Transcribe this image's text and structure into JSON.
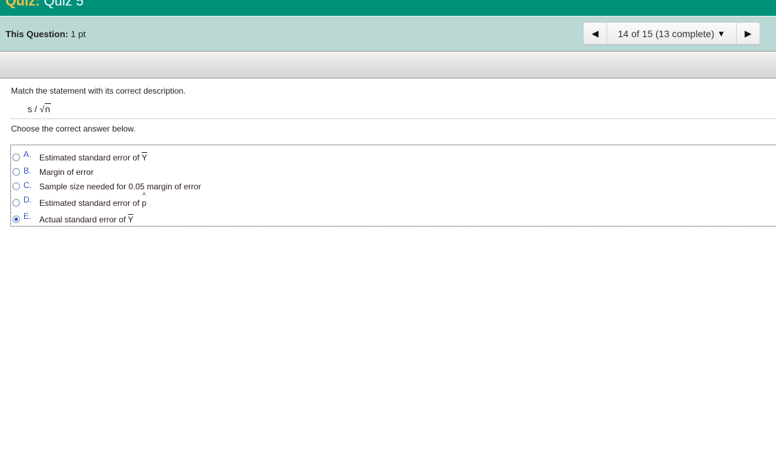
{
  "header": {
    "quiz_label": "Quiz:",
    "quiz_name": "Quiz 5"
  },
  "question_bar": {
    "label": "This Question:",
    "points": "1 pt"
  },
  "nav": {
    "position": "14 of 15 (13 complete)",
    "prev_icon": "triangle-left-icon",
    "next_icon": "triangle-right-icon",
    "dropdown_icon": "triangle-down-icon"
  },
  "question": {
    "instruction": "Match the statement with its correct description.",
    "formula_s": "s /",
    "formula_root": "√",
    "formula_n": "n",
    "prompt": "Choose the correct answer below."
  },
  "options": [
    {
      "letter": "A.",
      "text": "Estimated standard error of ",
      "symbol": "Y",
      "mark": "bar",
      "selected": false
    },
    {
      "letter": "B.",
      "text": "Margin of error",
      "selected": false
    },
    {
      "letter": "C.",
      "text": "Sample size needed for 0.05 margin of error",
      "selected": false
    },
    {
      "letter": "D.",
      "text": "Estimated standard error of ",
      "symbol": "p",
      "mark": "hat",
      "selected": false
    },
    {
      "letter": "E.",
      "text": "Actual standard error of ",
      "symbol": "Y",
      "mark": "bar",
      "selected": true
    }
  ],
  "colors": {
    "topbar": "#00917b",
    "question_bar": "#bad9d5",
    "accent": "#3158c4",
    "quiz_label": "#f6c343"
  }
}
